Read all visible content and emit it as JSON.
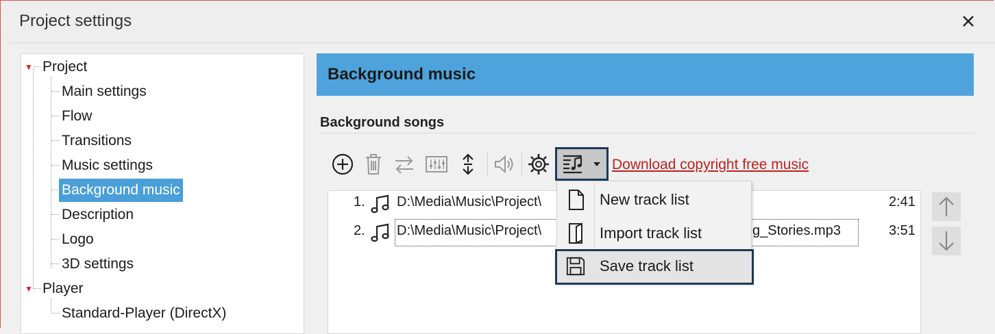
{
  "window": {
    "title": "Project settings",
    "close_glyph": "✕"
  },
  "tree": {
    "groups": [
      {
        "label": "Project",
        "expanded": true,
        "children": [
          "Main settings",
          "Flow",
          "Transitions",
          "Music settings",
          "Background music",
          "Description",
          "Logo",
          "3D settings"
        ],
        "selected": "Background music"
      },
      {
        "label": "Player",
        "expanded": true,
        "children": [
          "Standard-Player (DirectX)"
        ]
      }
    ]
  },
  "panel": {
    "header": "Background music",
    "group_label": "Background songs",
    "download_link": "Download copyright free music",
    "toolbar_icons": [
      "add-circle-icon",
      "trash-icon",
      "swap-icon",
      "mixer-icon",
      "sort-vertical-icon",
      "speaker-icon",
      "gear-icon",
      "tracklist-icon",
      "dropdown-caret-icon"
    ]
  },
  "songs": [
    {
      "num": "1.",
      "path": "D:\\Media\\Music\\Project\\",
      "suffix": "",
      "time": "2:41"
    },
    {
      "num": "2.",
      "path": "D:\\Media\\Music\\Project\\",
      "suffix": "g_Stories.mp3",
      "time": "3:51"
    }
  ],
  "menu": {
    "items": [
      {
        "label": "New track list",
        "icon": "new-document-icon"
      },
      {
        "label": "Import track list",
        "icon": "import-document-icon"
      },
      {
        "label": "Save track list",
        "icon": "floppy-disk-icon",
        "highlighted": true
      }
    ]
  },
  "colors": {
    "header_bg": "#4ea3dc",
    "selection_bg": "#4a9fd8",
    "link": "#c02020",
    "highlight_outline": "#1b3a5a"
  }
}
